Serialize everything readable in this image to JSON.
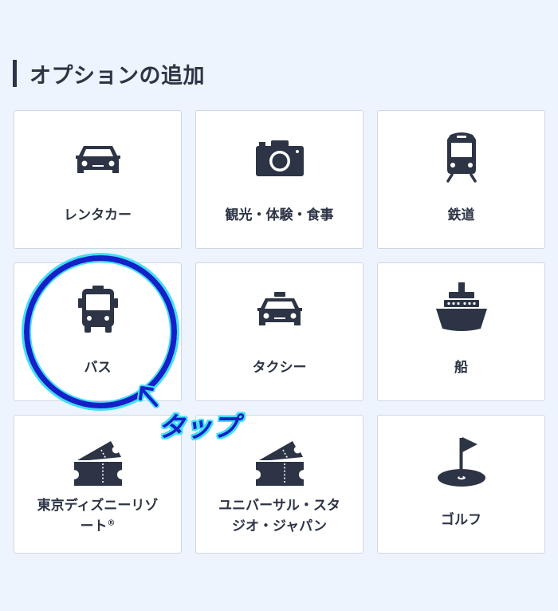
{
  "section": {
    "title": "オプションの追加"
  },
  "options": [
    {
      "label": "レンタカー",
      "icon": "car-icon"
    },
    {
      "label": "観光・体験・食事",
      "icon": "camera-icon"
    },
    {
      "label": "鉄道",
      "icon": "train-icon"
    },
    {
      "label": "バス",
      "icon": "bus-icon"
    },
    {
      "label": "タクシー",
      "icon": "taxi-icon"
    },
    {
      "label": "船",
      "icon": "ship-icon"
    },
    {
      "label_line1": "東京ディズニーリゾ",
      "label_line2": "ート",
      "label_mark": "®",
      "icon": "ticket-icon"
    },
    {
      "label_line1": "ユニバーサル・スタ",
      "label_line2": "ジオ・ジャパン",
      "icon": "ticket-icon"
    },
    {
      "label": "ゴルフ",
      "icon": "golf-flag-icon"
    }
  ],
  "annotation": {
    "tap_label": "タップ",
    "highlight_color": "#1620c8",
    "glow_color": "#3fe0f5"
  },
  "colors": {
    "background": "#eef4fd",
    "icon": "#2c3445",
    "card": "#ffffff"
  }
}
